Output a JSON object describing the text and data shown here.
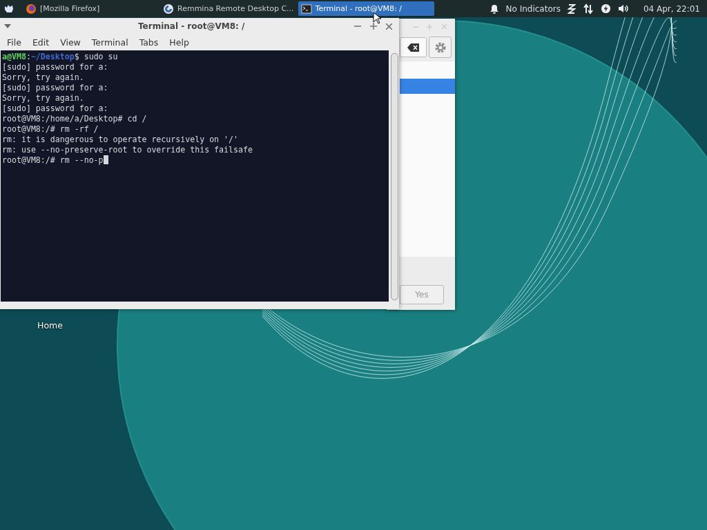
{
  "taskbar": {
    "tasks": [
      {
        "label": "[Mozilla Firefox]",
        "kind": "firefox",
        "selected": false
      },
      {
        "label": "Remmina Remote Desktop C...",
        "kind": "remmina",
        "selected": false
      },
      {
        "label": "Terminal - root@VM8: /",
        "kind": "terminal",
        "selected": true
      }
    ],
    "indicators": "No Indicators",
    "clock": "04 Apr, 22:01"
  },
  "desktop_icons": [
    {
      "label": "Home"
    }
  ],
  "background_window": {
    "selected_row": true,
    "button": "Yes"
  },
  "terminal_window": {
    "title": "Terminal - root@VM8: /",
    "menu": [
      "File",
      "Edit",
      "View",
      "Terminal",
      "Tabs",
      "Help"
    ],
    "lines": [
      {
        "kind": "prompt",
        "user": "a@VM8",
        "sep": ":",
        "path": "~/Desktop",
        "symbol": "$",
        "text": " sudo su"
      },
      {
        "kind": "output",
        "text": "[sudo] password for a:"
      },
      {
        "kind": "output",
        "text": "Sorry, try again."
      },
      {
        "kind": "output",
        "text": "[sudo] password for a:"
      },
      {
        "kind": "output",
        "text": "Sorry, try again."
      },
      {
        "kind": "output",
        "text": "[sudo] password for a:"
      },
      {
        "kind": "output",
        "text": "root@VM8:/home/a/Desktop# cd /"
      },
      {
        "kind": "output",
        "text": "root@VM8:/# rm -rf /"
      },
      {
        "kind": "output",
        "text": "rm: it is dangerous to operate recursively on '/'"
      },
      {
        "kind": "output",
        "text": "rm: use --no-preserve-root to override this failsafe"
      },
      {
        "kind": "input",
        "text": "root@VM8:/# rm --no-p"
      }
    ]
  }
}
